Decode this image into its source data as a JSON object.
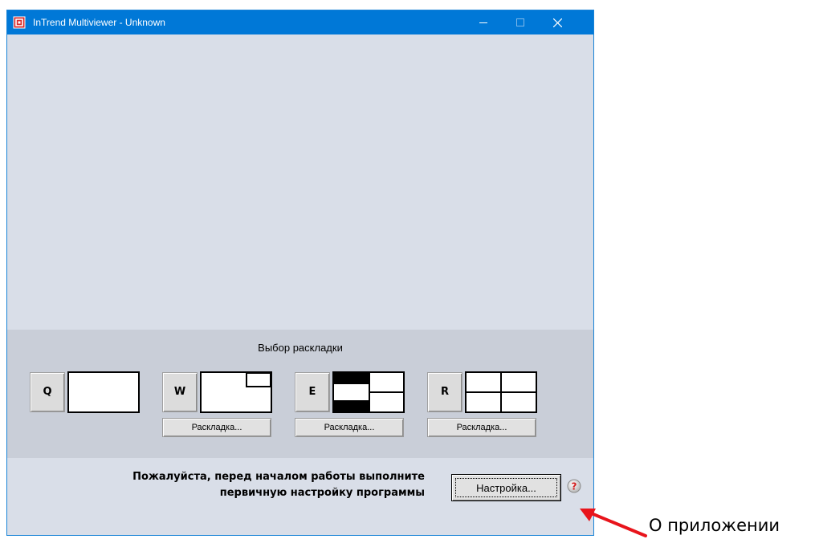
{
  "window": {
    "title": "InTrend Multiviewer - Unknown",
    "titlebar_color": "#0078d7",
    "controls": [
      "minimize-icon",
      "maximize-icon",
      "close-icon"
    ]
  },
  "layout_panel": {
    "title": "Выбор раскладки",
    "layouts": [
      {
        "key": "Q",
        "preview": "single",
        "has_settings_button": false
      },
      {
        "key": "W",
        "preview": "single-with-corner-inset",
        "has_settings_button": true,
        "settings_label": "Раскладка..."
      },
      {
        "key": "E",
        "preview": "one-left-two-right",
        "has_settings_button": true,
        "settings_label": "Раскладка..."
      },
      {
        "key": "R",
        "preview": "quad",
        "has_settings_button": true,
        "settings_label": "Раскладка..."
      }
    ]
  },
  "bottom": {
    "notice_line1": "Пожалуйста, перед началом работы выполните",
    "notice_line2": "первичную настройку программы",
    "settings_button": "Настройка...",
    "help_icon": "question-icon"
  },
  "annotation": {
    "label": "О приложении",
    "arrow_color": "#e8141b"
  }
}
